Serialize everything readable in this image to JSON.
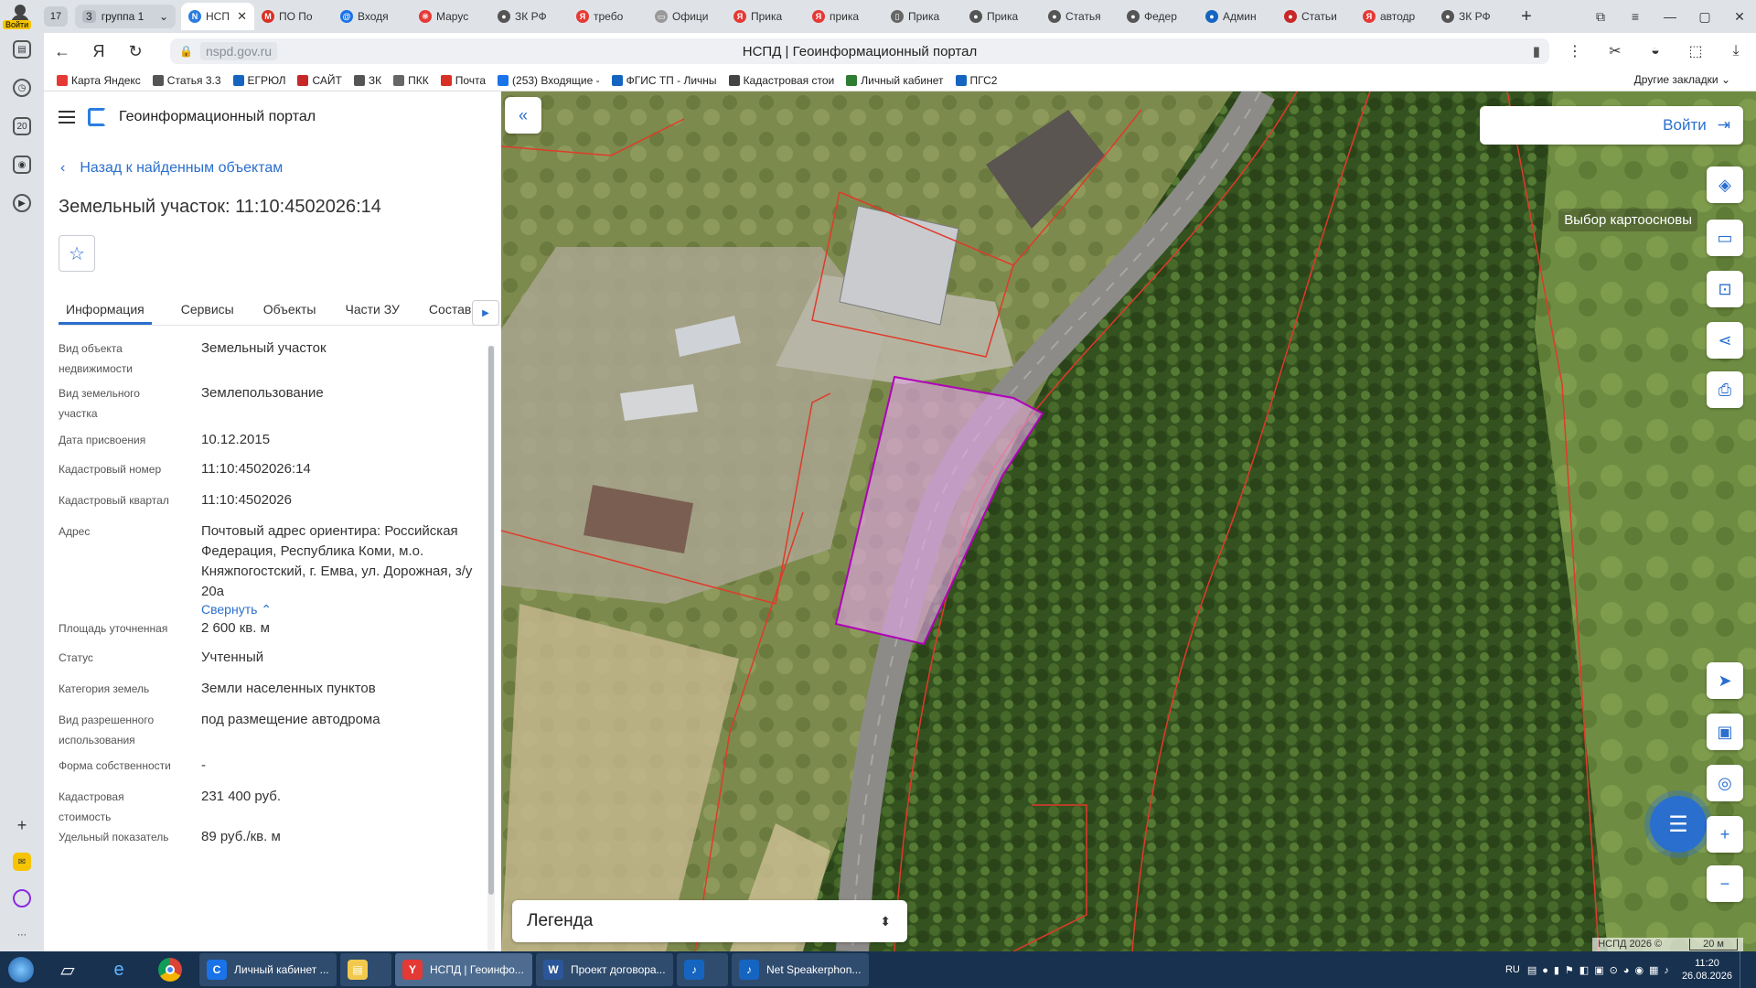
{
  "browser": {
    "profile_label": "Войти",
    "tab_count": "17",
    "group_count": "3",
    "group_name": "группа 1",
    "tabs": [
      {
        "label": "НСП",
        "color": "#2b7de1",
        "glyph": "N"
      },
      {
        "label": "ПО По",
        "color": "#d93025",
        "glyph": "M"
      },
      {
        "label": "Входя",
        "color": "#1a73e8",
        "glyph": "@"
      },
      {
        "label": "Марус",
        "color": "#e53935",
        "glyph": "❋"
      },
      {
        "label": "ЗК РФ",
        "color": "#555555",
        "glyph": "●"
      },
      {
        "label": "требо",
        "color": "#e53935",
        "glyph": "Я"
      },
      {
        "label": "Офици",
        "color": "#999999",
        "glyph": "▭"
      },
      {
        "label": "Прика",
        "color": "#e53935",
        "glyph": "Я"
      },
      {
        "label": "прика",
        "color": "#e53935",
        "glyph": "Я"
      },
      {
        "label": "Прика",
        "color": "#666666",
        "glyph": "▯"
      },
      {
        "label": "Прика",
        "color": "#555555",
        "glyph": "●"
      },
      {
        "label": "Статья",
        "color": "#555555",
        "glyph": "●"
      },
      {
        "label": "Федер",
        "color": "#555555",
        "glyph": "●"
      },
      {
        "label": "Админ",
        "color": "#1565c0",
        "glyph": "●"
      },
      {
        "label": "Статьи",
        "color": "#c62828",
        "glyph": "●"
      },
      {
        "label": "автодр",
        "color": "#e53935",
        "glyph": "Я"
      },
      {
        "label": "ЗК РФ",
        "color": "#555555",
        "glyph": "●"
      }
    ],
    "active_tab_index": 0,
    "url": "nspd.gov.ru",
    "page_title": "НСПД | Геоинформационный портал",
    "bookmarks": [
      {
        "label": "Карта Яндекс",
        "color": "#e53935"
      },
      {
        "label": "Статья 3.3",
        "color": "#555555"
      },
      {
        "label": "ЕГРЮЛ",
        "color": "#1565c0"
      },
      {
        "label": "САЙТ",
        "color": "#c62828"
      },
      {
        "label": "ЗК",
        "color": "#555555"
      },
      {
        "label": "ПКК",
        "color": "#666666"
      },
      {
        "label": "Почта",
        "color": "#d93025"
      },
      {
        "label": "(253) Входящие -",
        "color": "#1a73e8"
      },
      {
        "label": "ФГИС ТП - Личны",
        "color": "#1565c0"
      },
      {
        "label": "Кадастровая стои",
        "color": "#444444"
      },
      {
        "label": "Личный кабинет",
        "color": "#2e7d32"
      },
      {
        "label": "ПГС2",
        "color": "#1565c0"
      }
    ],
    "other_bookmarks": "Другие закладки",
    "sidebar_badge": "20"
  },
  "panel": {
    "brand": "Геоинформационный портал",
    "back_link": "Назад к найденным объектам",
    "title": "Земельный участок: 11:10:4502026:14",
    "tabs": [
      "Информация",
      "Сервисы",
      "Объекты",
      "Части ЗУ",
      "Состав"
    ],
    "active_tab": "Информация",
    "collapse_label": "Свернуть",
    "rows": [
      {
        "key": "Вид объекта недвижимости",
        "value": "Земельный участок"
      },
      {
        "key": "Вид земельного участка",
        "value": "Землепользование"
      },
      {
        "key": "Дата присвоения",
        "value": "10.12.2015"
      },
      {
        "key": "Кадастровый номер",
        "value": "11:10:4502026:14"
      },
      {
        "key": "Кадастровый квартал",
        "value": "11:10:4502026"
      },
      {
        "key": "Адрес",
        "value": "Почтовый адрес ориентира: Российская Федерация, Республика Коми, м.о. Княжпогостский, г. Емва, ул. Дорожная, з/у 20а"
      },
      {
        "key": "Площадь уточненная",
        "value": "2 600 кв. м"
      },
      {
        "key": "Статус",
        "value": "Учтенный"
      },
      {
        "key": "Категория земель",
        "value": "Земли населенных пунктов"
      },
      {
        "key": "Вид разрешенного использования",
        "value": "под размещение автодрома"
      },
      {
        "key": "Форма собственности",
        "value": "-"
      },
      {
        "key": "Кадастровая стоимость",
        "value": "231 400 руб."
      },
      {
        "key": "Удельный показатель",
        "value": "89 руб./кв. м"
      }
    ]
  },
  "map": {
    "login_label": "Войти",
    "basemap_tooltip": "Выбор картоосновы",
    "legend_label": "Легенда",
    "attribution": "НСПД 2026 ©",
    "scale": "20 м"
  },
  "taskbar": {
    "tasks": [
      {
        "label": "Личный кабинет ...",
        "color": "#1a73e8",
        "glyph": "C"
      },
      {
        "label": "",
        "color": "#f2c94c",
        "glyph": "▤"
      },
      {
        "label": "НСПД | Геоинфо...",
        "color": "#e53935",
        "glyph": "Y"
      },
      {
        "label": "Проект договора...",
        "color": "#2b579a",
        "glyph": "W"
      },
      {
        "label": "",
        "color": "#1565c0",
        "glyph": "♪"
      },
      {
        "label": "Net Speakerphon...",
        "color": "#1565c0",
        "glyph": "♪"
      }
    ],
    "lang": "RU",
    "time": "11:20",
    "date": "26.08.2026"
  }
}
